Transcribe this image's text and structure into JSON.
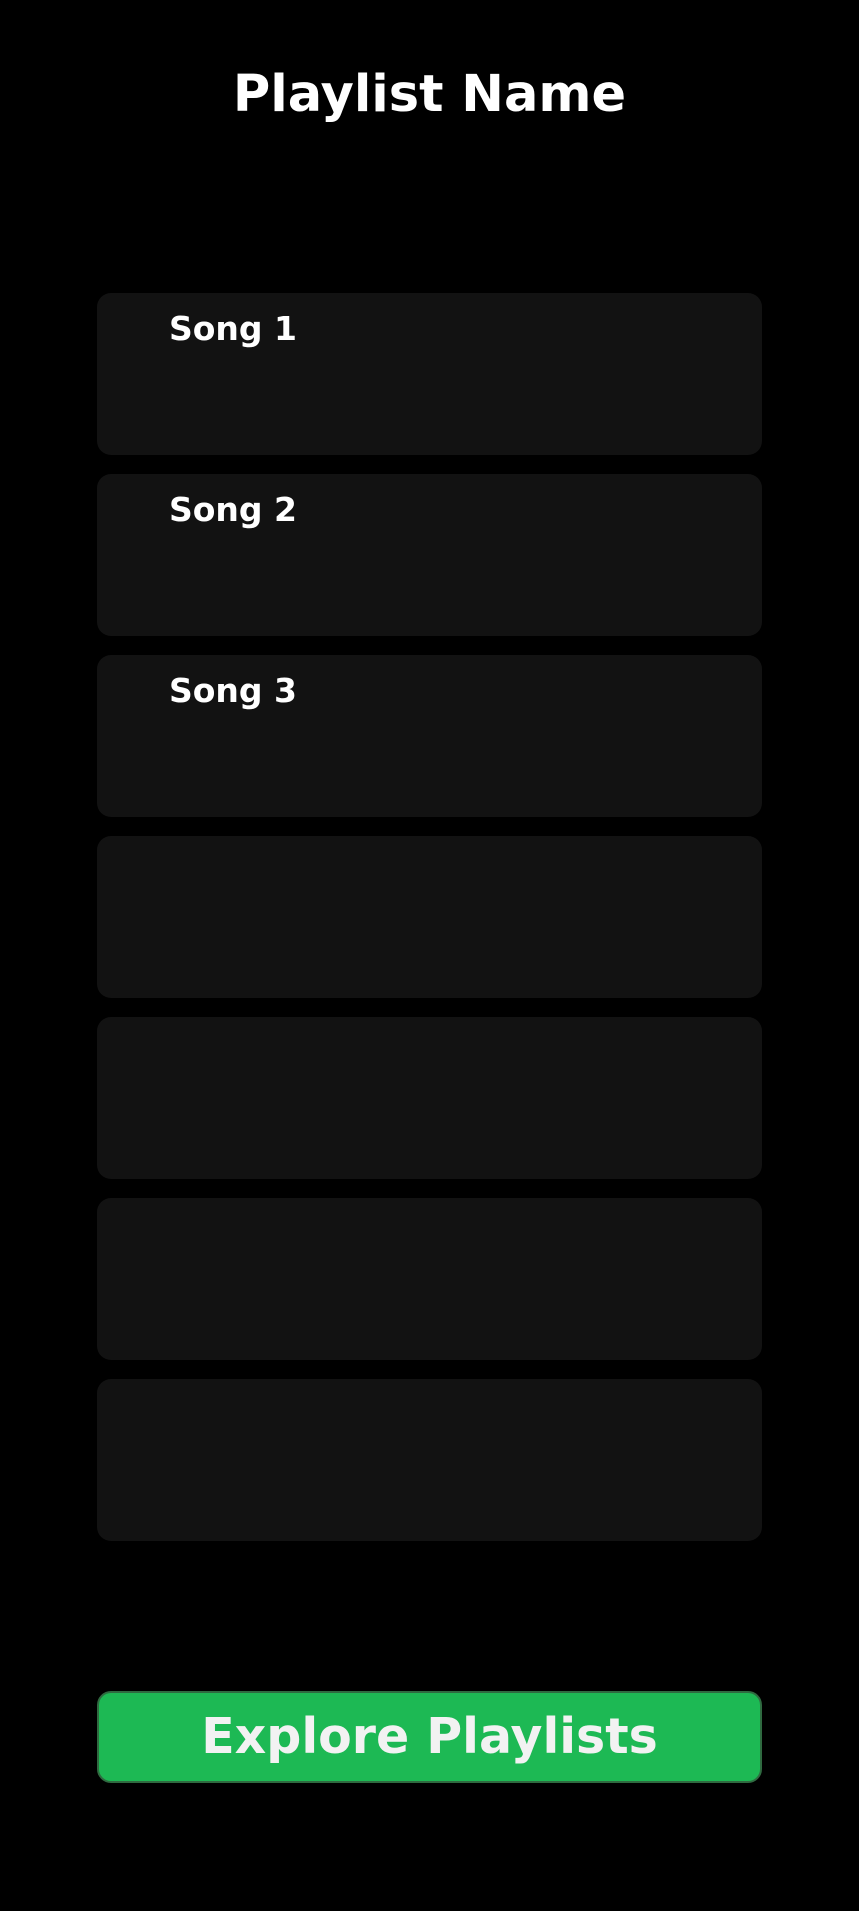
{
  "header": {
    "title": "Playlist Name"
  },
  "songs": [
    {
      "title": "Song 1"
    },
    {
      "title": "Song 2"
    },
    {
      "title": "Song 3"
    },
    {
      "title": ""
    },
    {
      "title": ""
    },
    {
      "title": ""
    },
    {
      "title": ""
    }
  ],
  "footer": {
    "explore_label": "Explore Playlists"
  },
  "colors": {
    "background": "#000000",
    "card": "#121212",
    "accent": "#1db954",
    "text": "#ffffff"
  }
}
